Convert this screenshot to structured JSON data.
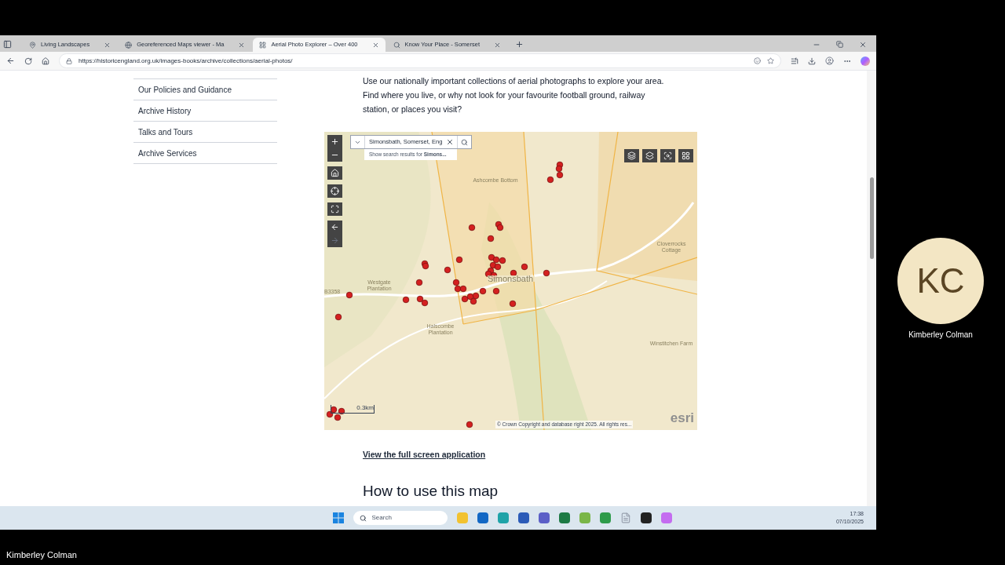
{
  "browser": {
    "tabs": [
      {
        "title": "Living Landscapes",
        "selected": false
      },
      {
        "title": "Georeferenced Maps viewer - Ma",
        "selected": false
      },
      {
        "title": "Aerial Photo Explorer – Over 400",
        "selected": true
      },
      {
        "title": "Know Your Place - Somerset",
        "selected": false
      }
    ],
    "url": "https://historicengland.org.uk/images-books/archive/collections/aerial-photos/"
  },
  "sidebar": {
    "items": [
      "Our Policies and Guidance",
      "Archive History",
      "Talks and Tours",
      "Archive Services"
    ]
  },
  "intro": "Use our nationally important collections of aerial photographs to explore your area. Find where you live, or why not look for your favourite football ground, railway station, or places you visit?",
  "map": {
    "search": {
      "value": "Simonsbath, Somerset, Eng",
      "suggestion": "Show search results for **Simons...**"
    },
    "labels": [
      "Ashcombe Bottom",
      "Westgate Plantation",
      "Simonsbath",
      "Halscombe Plantation",
      "Winstitchen Farm",
      "Cloverrocks Cottage",
      "B3358"
    ],
    "scale": "0.3km",
    "attribution": "© Crown Copyright and database right 2025. All rights res...",
    "logo": "esri"
  },
  "link": "View the full screen application",
  "heading": "How to use this map",
  "taskbar": {
    "search_placeholder": "Search",
    "time": "17:38",
    "date": "07/10/2025"
  },
  "participant": {
    "initials": "KC",
    "name": "Kimberley Colman"
  },
  "presenter": "Kimberley Colman"
}
